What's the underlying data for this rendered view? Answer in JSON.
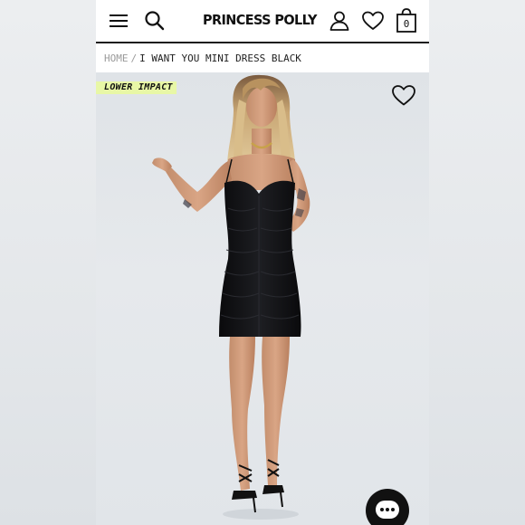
{
  "header": {
    "brand": "PRINCESS POLLY",
    "bag_count": "0",
    "icons": [
      "menu-icon",
      "search-icon",
      "account-icon",
      "heart-icon",
      "shopping-bag-icon"
    ]
  },
  "breadcrumb": {
    "home": "HOME",
    "separator": "/",
    "current": "I WANT YOU MINI DRESS BLACK"
  },
  "product": {
    "badge": "LOWER IMPACT",
    "wishlist_icon": "heart-outline-icon",
    "image_subject": "model wearing black ruched mini dress"
  },
  "chat": {
    "icon": "chat-bubble-icon"
  },
  "colors": {
    "badge_bg": "#e8f7a6",
    "text": "#111111",
    "breadcrumb_muted": "#9a9a9a",
    "dress": "#121214",
    "background": "#e3e6ea"
  }
}
